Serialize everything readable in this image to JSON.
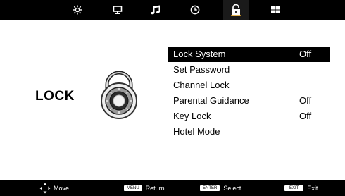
{
  "tabs": [
    {
      "icon": "picture-settings-icon"
    },
    {
      "icon": "screen-icon"
    },
    {
      "icon": "music-note-icon"
    },
    {
      "icon": "clock-icon"
    },
    {
      "icon": "padlock-icon",
      "active": true
    },
    {
      "icon": "grid-icon"
    }
  ],
  "section": {
    "title": "LOCK"
  },
  "menu": {
    "items": [
      {
        "label": "Lock System",
        "value": "Off",
        "selected": true
      },
      {
        "label": "Set Password",
        "value": ""
      },
      {
        "label": "Channel Lock",
        "value": ""
      },
      {
        "label": "Parental Guidance",
        "value": "Off"
      },
      {
        "label": "Key Lock",
        "value": "Off"
      },
      {
        "label": "Hotel Mode",
        "value": ""
      }
    ]
  },
  "footer": {
    "move_label": "Move",
    "menu_key": "MENU",
    "return_label": "Return",
    "enter_key": "ENTER",
    "select_label": "Select",
    "exit_key": "EXIT",
    "exit_label": "Exit"
  },
  "colors": {
    "bar": "#000000",
    "selected_bg": "#000000",
    "selected_fg": "#ffffff"
  }
}
